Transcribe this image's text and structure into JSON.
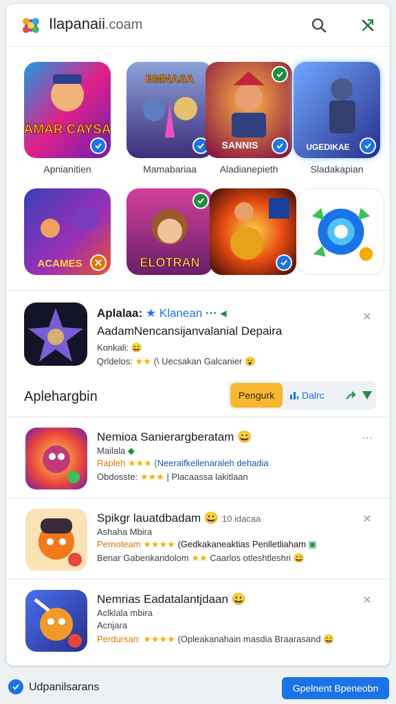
{
  "header": {
    "site_name": "Ilapanaii",
    "site_domain": ".coam",
    "search_icon": "search-icon",
    "share_icon": "share-icon"
  },
  "grid": {
    "tiles": [
      {
        "label": "Apnianitien",
        "art_text": "BAMAR CAYSAN",
        "bg": "#e0208a"
      },
      {
        "label": "Mamabariaa",
        "art_text": "BMNASA",
        "bg": "#5a6fb3"
      },
      {
        "label": "Aladianepieth",
        "art_text": "SANNIS",
        "bg": "#d84a16"
      },
      {
        "label": "Sladakapian",
        "art_text": "UGEDIKAE",
        "bg": "#3d6fd8"
      },
      {
        "label": "",
        "art_text": "ACAMES",
        "bg": "#5c2a8c"
      },
      {
        "label": "",
        "art_text": "ELOTRAN",
        "bg": "#a2308a"
      },
      {
        "label": "",
        "art_text": "",
        "bg": "#e54a10"
      },
      {
        "label": "",
        "art_text": "",
        "bg": "#ffffff"
      }
    ]
  },
  "featured": {
    "title": "Aplalaa:",
    "title_tag": "Klanean",
    "description": "AadamNencansijanvalanial Depaira",
    "meta": "Konkali: 😀",
    "rating_label": "Qrldelos:",
    "stars": "★★",
    "rating_text": "(\\ Uecsakan Galcanier 😮"
  },
  "section": {
    "title": "Aplehargbin",
    "popular_label": "Pengurk",
    "dalic_label": "Dalrc"
  },
  "list": [
    {
      "title": "Nemioa Sanierargberatam 😀",
      "subtitle": "Mailala",
      "line3_prefix": "Rapleh",
      "line3_stars": "★★★",
      "line3_text": "(Neeraifkellenaraleh dehadia",
      "line4_prefix": "Obdosste:",
      "line4_stars": "★★★",
      "line4_text": "| Placaassa lakitlaan",
      "menu": "⋯"
    },
    {
      "title": "Spikgr lauatdbadam 😀",
      "title_extra": "10 idacaa",
      "subtitle": "Ashaha Mbira",
      "line3_prefix": "Pernoteam",
      "line3_stars": "★★★★",
      "line3_text": "(Gedkakaneaktias Penlletliaham",
      "line4_prefix": "Benar Gabenkandolom",
      "line4_stars": "★★",
      "line4_text": "Caarlos otleshtleshri 😀",
      "menu": "✕"
    },
    {
      "title": "Nemrias Eadatalantjdaan 😀",
      "subtitle": "Aclklala mbira",
      "line3_prefix": "Acnjara",
      "line3_stars": "",
      "line3_text": "",
      "line4_prefix": "Perdursan:",
      "line4_stars": "★★★★",
      "line4_text": "(Opleakanahain masdia Braarasand 😀",
      "menu": "✕"
    }
  ],
  "footer": {
    "label": "Udpanilsarans",
    "button": "Gpelnent Bpeneobn"
  },
  "colors": {
    "accent": "#1a73e8",
    "star": "#f9ab00",
    "popular": "#f7b731"
  }
}
